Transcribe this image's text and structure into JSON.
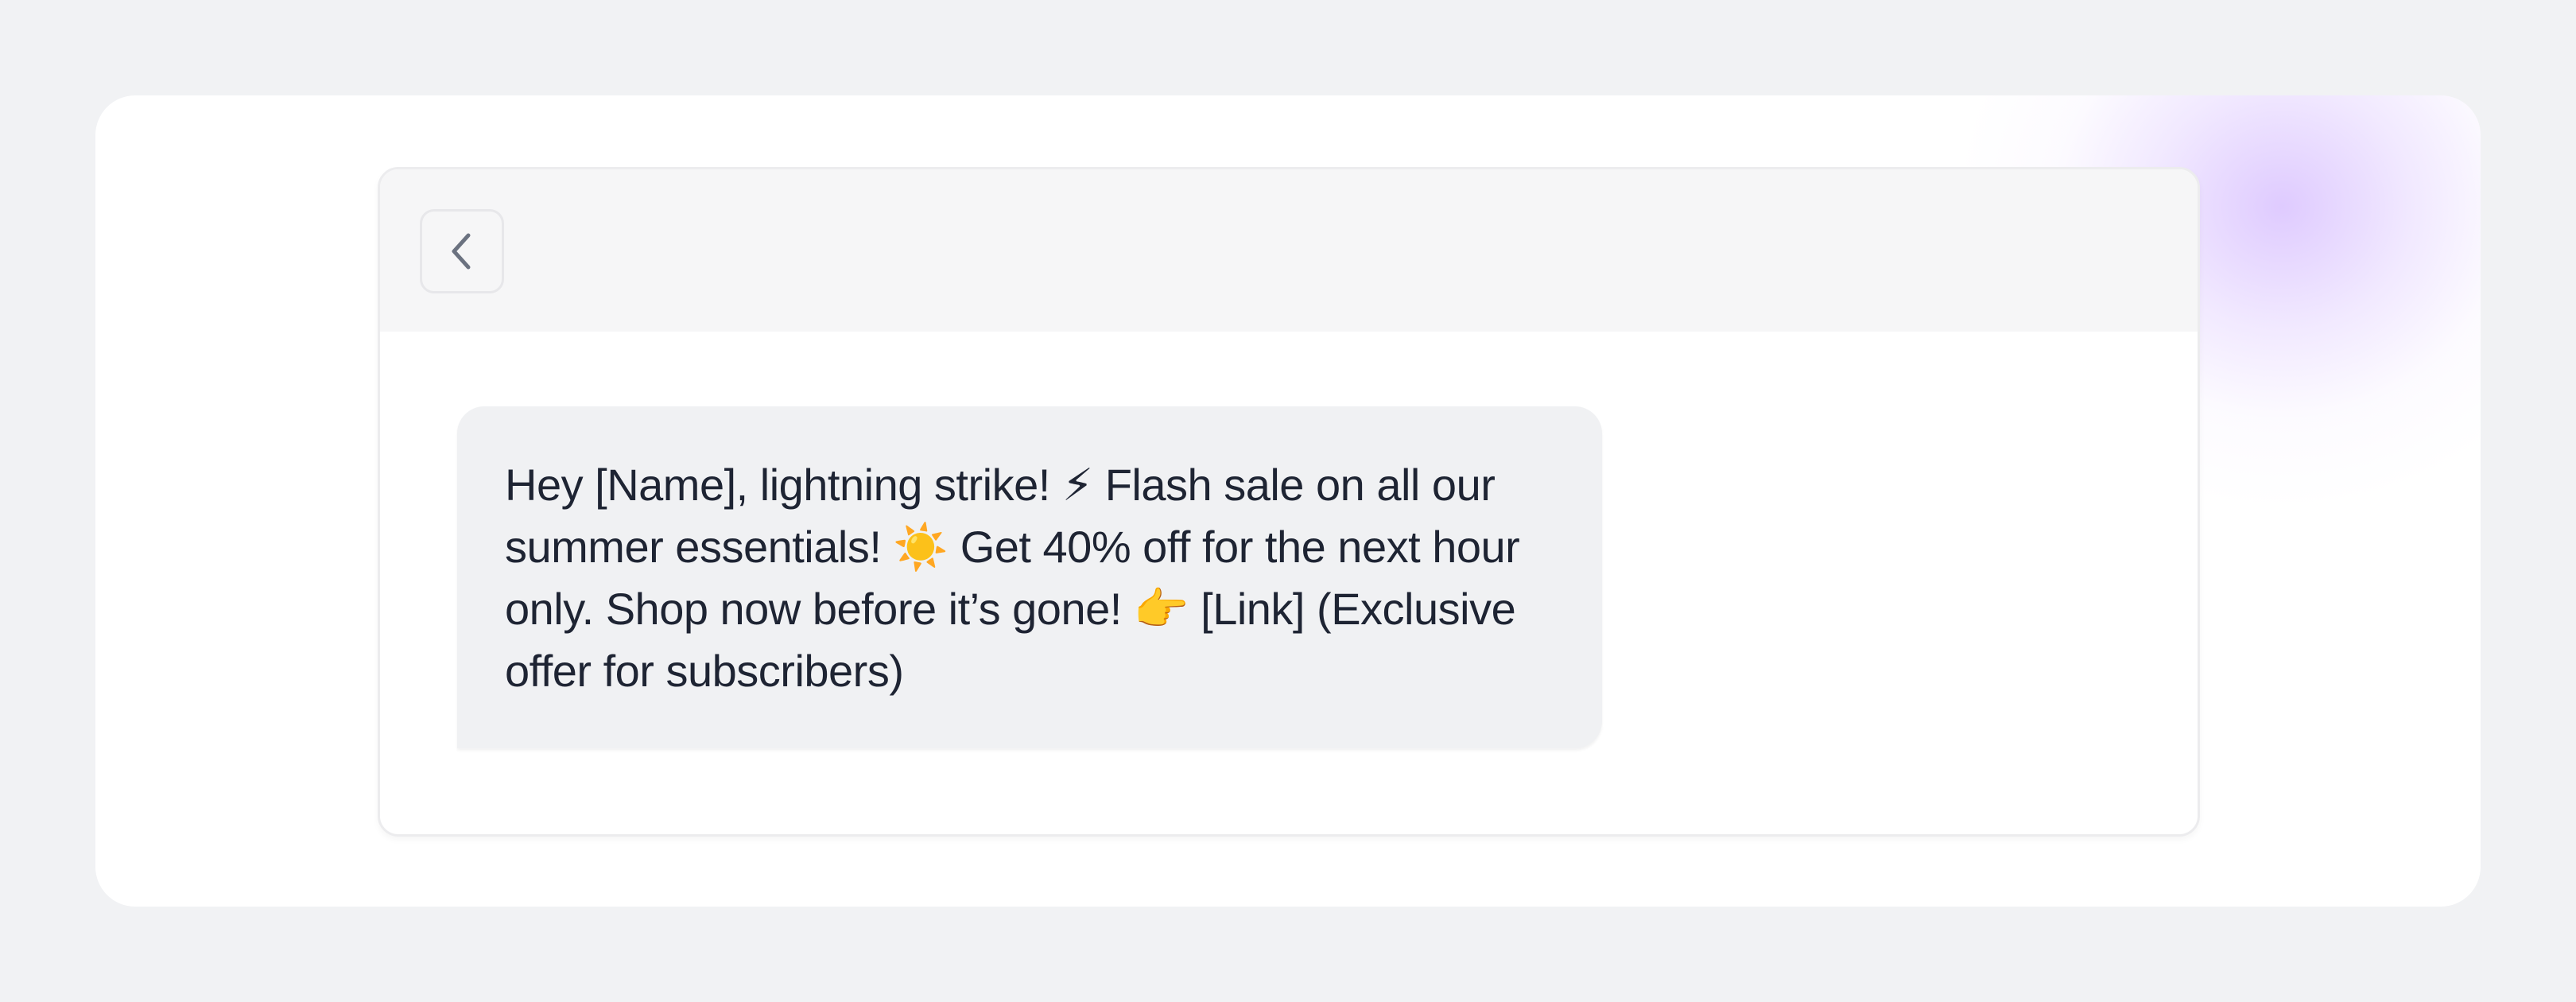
{
  "header": {
    "back_icon": "chevron-left-icon"
  },
  "message": {
    "text": "Hey [Name], lightning strike! ⚡ Flash sale on all our summer essentials! ☀️ Get 40% off for the next hour only. Shop now before it’s gone! 👉 [Link] (Exclusive offer for subscribers)"
  },
  "colors": {
    "page_background": "#f1f2f4",
    "card_background": "#ffffff",
    "header_background": "#f6f6f7",
    "bubble_background": "#f0f1f3",
    "text": "#1e2433",
    "icon": "#6b7280",
    "accent_glow": "#ddc8ff"
  }
}
